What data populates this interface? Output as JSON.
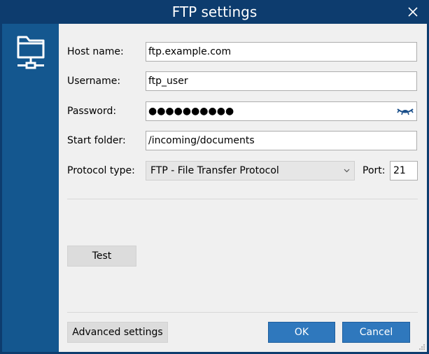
{
  "window": {
    "title": "FTP settings",
    "colors": {
      "titlebar": "#0d3c6e",
      "sidebar": "#14578f",
      "accent": "#2f78bd"
    }
  },
  "sidebar": {
    "icon": "network-folder-icon"
  },
  "form": {
    "host_label": "Host name:",
    "host_value": "ftp.example.com",
    "username_label": "Username:",
    "username_value": "ftp_user",
    "password_label": "Password:",
    "password_value": "●●●●●●●●●●",
    "start_folder_label": "Start folder:",
    "start_folder_value": "/incoming/documents",
    "protocol_label": "Protocol type:",
    "protocol_value": "FTP - File Transfer Protocol",
    "port_label": "Port:",
    "port_value": "21"
  },
  "buttons": {
    "test": "Test",
    "advanced": "Advanced settings",
    "ok": "OK",
    "cancel": "Cancel"
  }
}
